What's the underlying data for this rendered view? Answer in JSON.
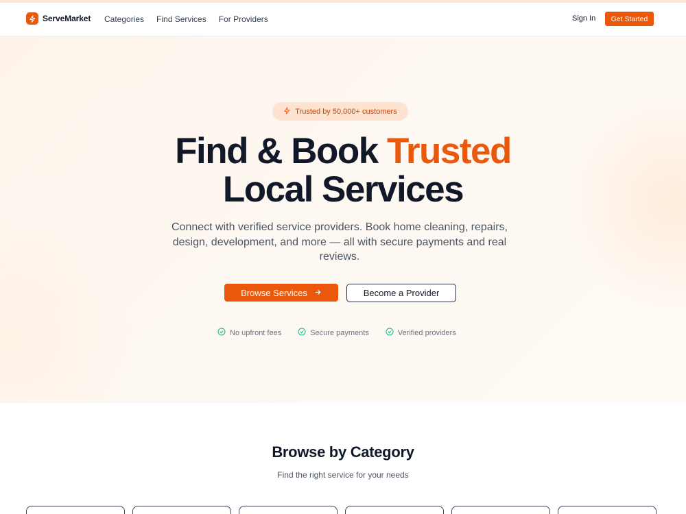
{
  "nav": {
    "brand": "ServeMarket",
    "links": [
      "Categories",
      "Find Services",
      "For Providers"
    ],
    "sign_in": "Sign In",
    "get_started": "Get Started"
  },
  "hero": {
    "badge": "Trusted by 50,000+ customers",
    "headline_part1": "Find & Book ",
    "headline_accent": "Trusted",
    "headline_line2": "Local Services",
    "subtext": "Connect with verified service providers. Book home cleaning, repairs, design, development, and more — all with secure payments and real reviews.",
    "primary_cta": "Browse Services",
    "secondary_cta": "Become a Provider",
    "features": [
      "No upfront fees",
      "Secure payments",
      "Verified providers"
    ]
  },
  "categories": {
    "title": "Browse by Category",
    "subtitle": "Find the right service for your needs"
  },
  "colors": {
    "accent": "#ea580c",
    "badge_bg": "#fde3d0",
    "check": "#10b981"
  },
  "icons": {
    "brand": "lightning-icon",
    "badge": "lightning-icon",
    "cta": "arrow-right-icon",
    "feature": "check-circle-icon"
  }
}
